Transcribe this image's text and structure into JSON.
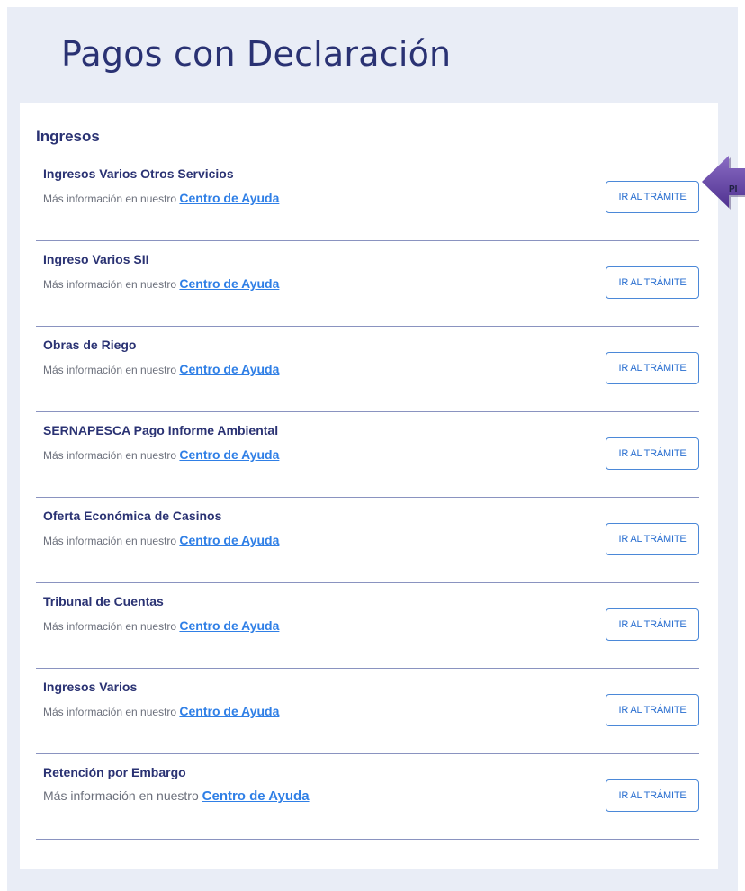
{
  "page": {
    "title": "Pagos con Declaración"
  },
  "section": {
    "title": "Ingresos"
  },
  "help_prefix": "Más información en nuestro ",
  "help_link_label": "Centro de Ayuda",
  "button_label": "IR AL TRÁMITE",
  "items": [
    {
      "title": "Ingresos Varios Otros Servicios"
    },
    {
      "title": "Ingreso Varios SII"
    },
    {
      "title": "Obras de Riego"
    },
    {
      "title": "SERNAPESCA Pago Informe Ambiental"
    },
    {
      "title": "Oferta Económica de Casinos"
    },
    {
      "title": "Tribunal de Cuentas"
    },
    {
      "title": "Ingresos Varios"
    },
    {
      "title": "Retención por Embargo"
    }
  ],
  "annotation": {
    "label": "PI",
    "color": "#6a4aa8"
  },
  "colors": {
    "background": "#e9edf6",
    "title": "#2a3273",
    "link": "#2f7fe6",
    "button_border": "#4b88d8",
    "divider": "#8a93c0"
  }
}
